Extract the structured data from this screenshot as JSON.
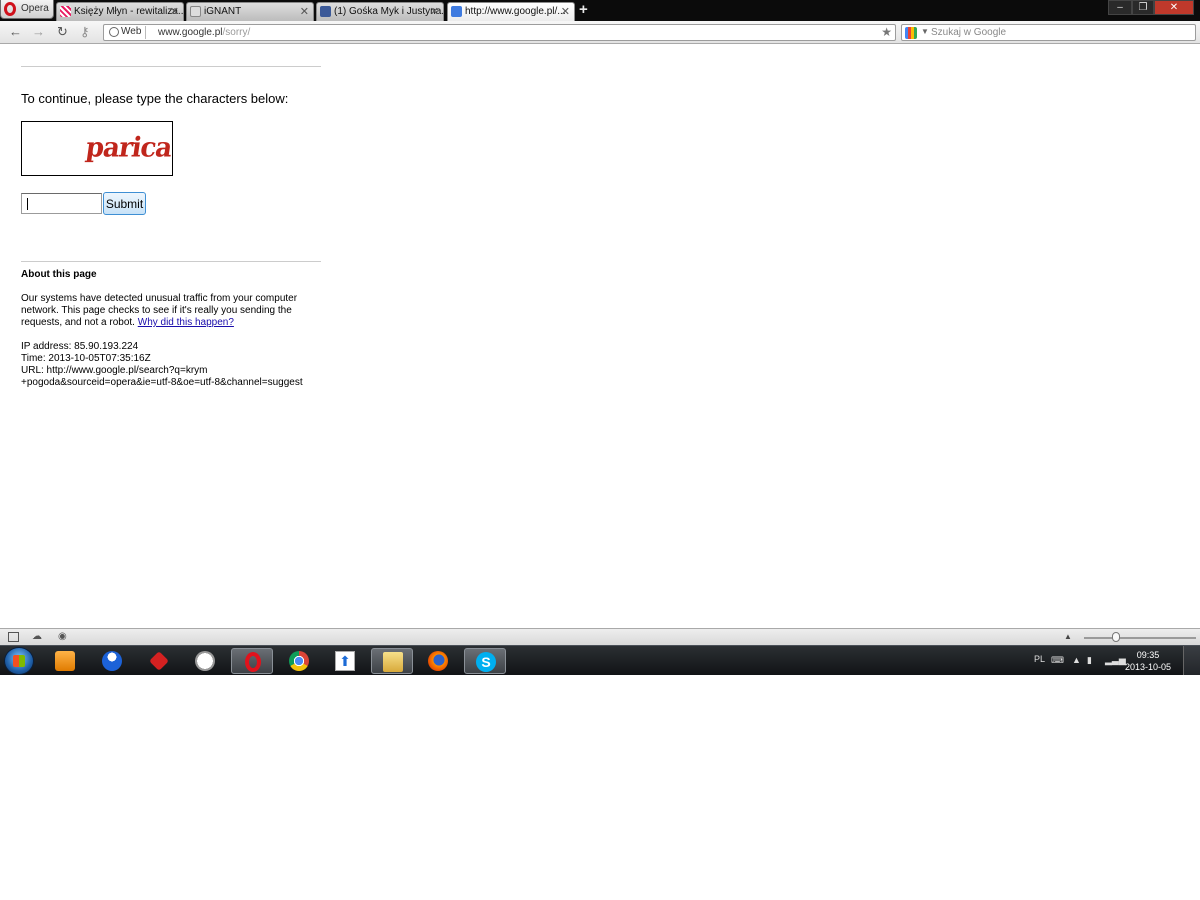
{
  "browser": {
    "menu_label": "Opera",
    "tabs": [
      {
        "title": "Księży Młyn - rewitaliza...",
        "icon": "ksiezy-mlyn-favicon"
      },
      {
        "title": "iGNANT",
        "icon": "ignant-favicon"
      },
      {
        "title": "(1) Gośka Myk i Justyna...",
        "icon": "facebook-favicon"
      },
      {
        "title": "http://www.google.pl/...",
        "icon": "google-favicon",
        "active": true
      }
    ],
    "address": {
      "badge": "Web",
      "url_host": "www.google.pl",
      "url_path": "/sorry/"
    },
    "search_placeholder": "Szukaj w Google"
  },
  "page": {
    "prompt": "To continue, please type the characters below:",
    "captcha_text": "parica",
    "answer_value": "",
    "submit_label": "Submit",
    "about_title": "About this page",
    "about_text": "Our systems have detected unusual traffic from your computer network. This page checks to see if it's really you sending the requests, and not a robot.",
    "about_link": "Why did this happen?",
    "ip_line": "IP address: 85.90.193.224",
    "time_line": "Time: 2013-10-05T07:35:16Z",
    "url_line_1": "URL: http://www.google.pl/search?q=krym",
    "url_line_2": "+pogoda&sourceid=opera&ie=utf-8&oe=utf-8&channel=suggest"
  },
  "taskbar": {
    "apps": [
      "windows-media-player",
      "messenger",
      "pushpin",
      "clock",
      "opera",
      "chrome",
      "upload",
      "file-explorer",
      "firefox",
      "skype"
    ],
    "active_app": "opera",
    "language": "PL",
    "time": "09:35",
    "date": "2013-10-05"
  },
  "colors": {
    "captcha_red": "#c0261c",
    "link_blue": "#1a0dab",
    "taskbar_dark": "#111316"
  }
}
